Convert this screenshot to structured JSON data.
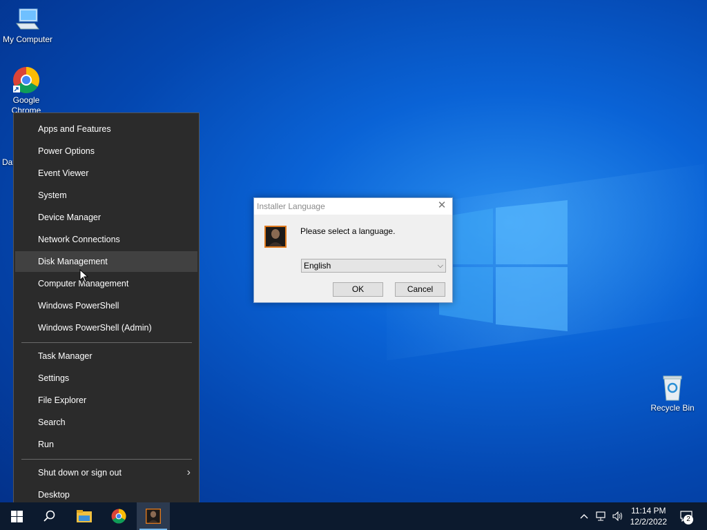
{
  "desktop": {
    "icons": [
      {
        "label": "My Computer"
      },
      {
        "label": "Google Chrome"
      },
      {
        "label": "Dat"
      },
      {
        "label": "Recycle Bin"
      }
    ]
  },
  "winx_menu": {
    "items": [
      {
        "label": "Apps and Features"
      },
      {
        "label": "Power Options"
      },
      {
        "label": "Event Viewer"
      },
      {
        "label": "System"
      },
      {
        "label": "Device Manager"
      },
      {
        "label": "Network Connections"
      },
      {
        "label": "Disk Management"
      },
      {
        "label": "Computer Management"
      },
      {
        "label": "Windows PowerShell"
      },
      {
        "label": "Windows PowerShell (Admin)"
      },
      {
        "label": "Task Manager"
      },
      {
        "label": "Settings"
      },
      {
        "label": "File Explorer"
      },
      {
        "label": "Search"
      },
      {
        "label": "Run"
      },
      {
        "label": "Shut down or sign out"
      },
      {
        "label": "Desktop"
      }
    ],
    "hovered": "Disk Management"
  },
  "dialog": {
    "title": "Installer Language",
    "message": "Please select a language.",
    "language_selected": "English",
    "ok_label": "OK",
    "cancel_label": "Cancel"
  },
  "taskbar": {
    "time": "11:14 PM",
    "date": "12/2/2022",
    "notification_count": "2"
  },
  "colors": {
    "desktop_blue": "#0a63d6",
    "menu_bg": "#2b2b2b",
    "taskbar_bg": "#0c1a2e"
  }
}
